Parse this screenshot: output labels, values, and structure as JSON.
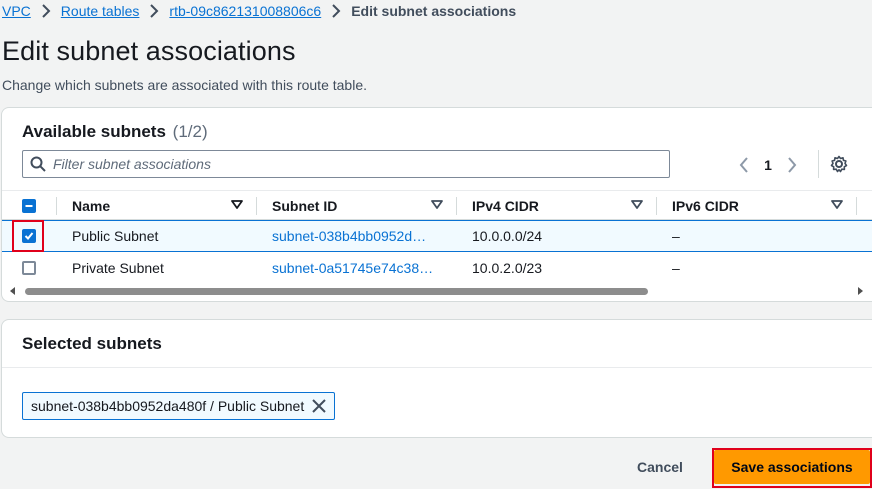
{
  "breadcrumb": {
    "items": [
      "VPC",
      "Route tables",
      "rtb-09c862131008806c6"
    ],
    "current": "Edit subnet associations"
  },
  "page": {
    "title": "Edit subnet associations",
    "description": "Change which subnets are associated with this route table."
  },
  "available": {
    "heading": "Available subnets",
    "count": "(1/2)",
    "filter_placeholder": "Filter subnet associations",
    "page_number": "1",
    "columns": [
      "Name",
      "Subnet ID",
      "IPv4 CIDR",
      "IPv6 CIDR"
    ],
    "rows": [
      {
        "name": "Public Subnet",
        "subnet_id": "subnet-038b4bb0952d…",
        "ipv4": "10.0.0.0/24",
        "ipv6": "–",
        "selected": true
      },
      {
        "name": "Private Subnet",
        "subnet_id": "subnet-0a51745e74c38…",
        "ipv4": "10.0.2.0/23",
        "ipv6": "–",
        "selected": false
      }
    ]
  },
  "selected": {
    "heading": "Selected subnets",
    "token": "subnet-038b4bb0952da480f / Public Subnet"
  },
  "footer": {
    "cancel_label": "Cancel",
    "save_label": "Save associations"
  },
  "colors": {
    "accent": "#0972d3",
    "primary_button": "#ff9900",
    "highlight": "#e0001b"
  },
  "icons": [
    "chevron-right-icon",
    "search-icon",
    "chevron-left-icon",
    "gear-icon",
    "sort-down-icon",
    "close-icon",
    "check-icon"
  ]
}
